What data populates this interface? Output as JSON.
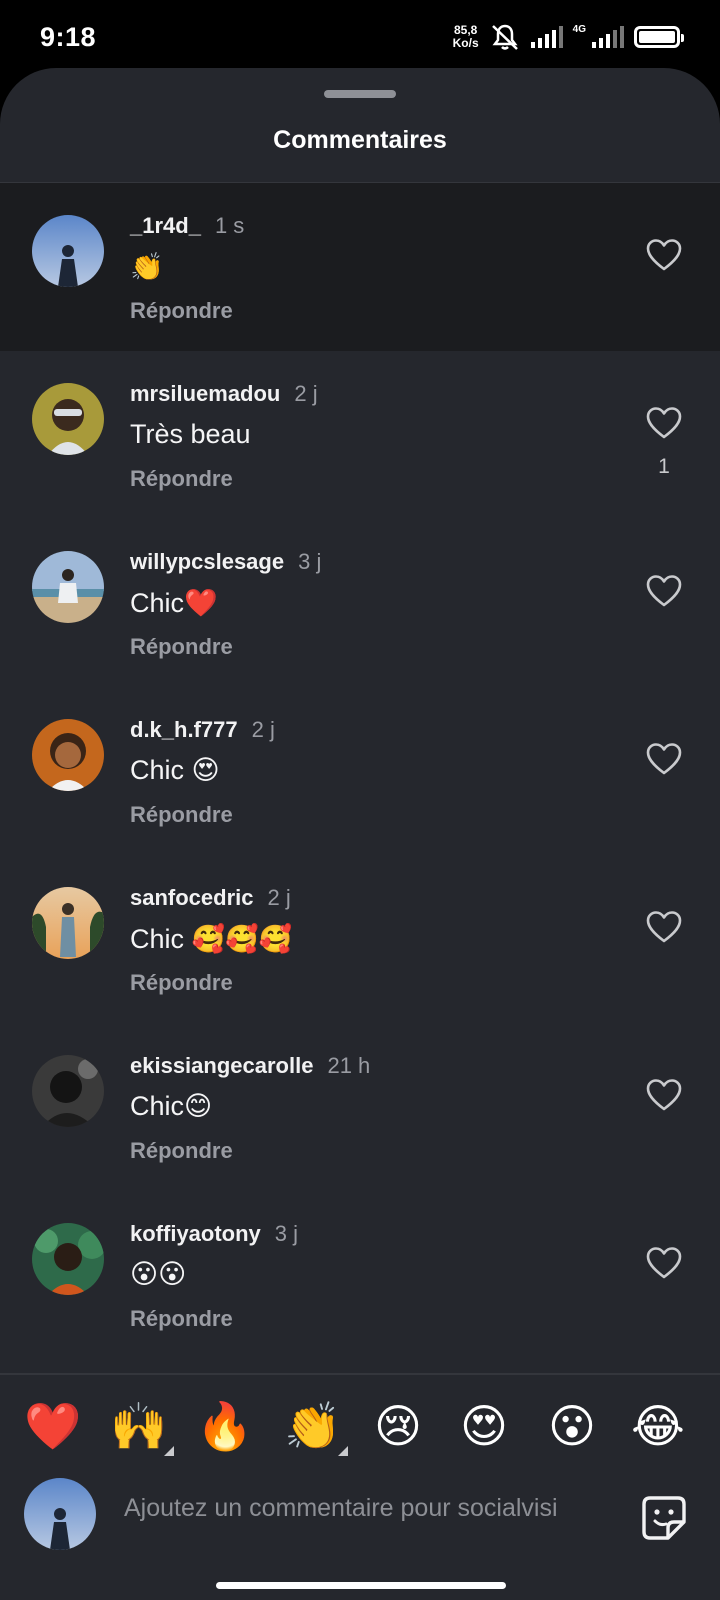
{
  "status_bar": {
    "time": "9:18",
    "net_speed_value": "85,8",
    "net_speed_unit": "Ko/s",
    "network_type": "4G",
    "icons": [
      "mute-icon",
      "signal-icon",
      "signal-4g-icon",
      "battery-icon"
    ]
  },
  "sheet": {
    "title": "Commentaires"
  },
  "comments": [
    {
      "user": "_1r4d_",
      "time": "1 s",
      "text": "👏",
      "reply": "Répondre",
      "likes": "",
      "highlighted": true
    },
    {
      "user": "mrsiluemadou",
      "time": "2 j",
      "text": "Très beau",
      "reply": "Répondre",
      "likes": "1"
    },
    {
      "user": "willypcslesage",
      "time": "3 j",
      "text": "Chic❤️",
      "reply": "Répondre",
      "likes": ""
    },
    {
      "user": "d.k_h.f777",
      "time": "2 j",
      "text": "Chic 😍",
      "reply": "Répondre",
      "likes": ""
    },
    {
      "user": "sanfocedric",
      "time": "2 j",
      "text": "Chic 🥰🥰🥰",
      "reply": "Répondre",
      "likes": ""
    },
    {
      "user": "ekissiangecarolle",
      "time": "21 h",
      "text": "Chic😊",
      "reply": "Répondre",
      "likes": ""
    },
    {
      "user": "koffiyaotony",
      "time": "3 j",
      "text": "😮😮",
      "reply": "Répondre",
      "likes": ""
    }
  ],
  "emoji_bar": [
    "❤️",
    "🙌",
    "🔥",
    "👏",
    "😢",
    "😍",
    "😮",
    "😂"
  ],
  "composer": {
    "placeholder": "Ajoutez un commentaire pour socialvisi"
  },
  "colors": {
    "sheet_bg": "#25272d",
    "highlight_bg": "#1b1c1f",
    "muted_text": "#9a9ca3"
  }
}
